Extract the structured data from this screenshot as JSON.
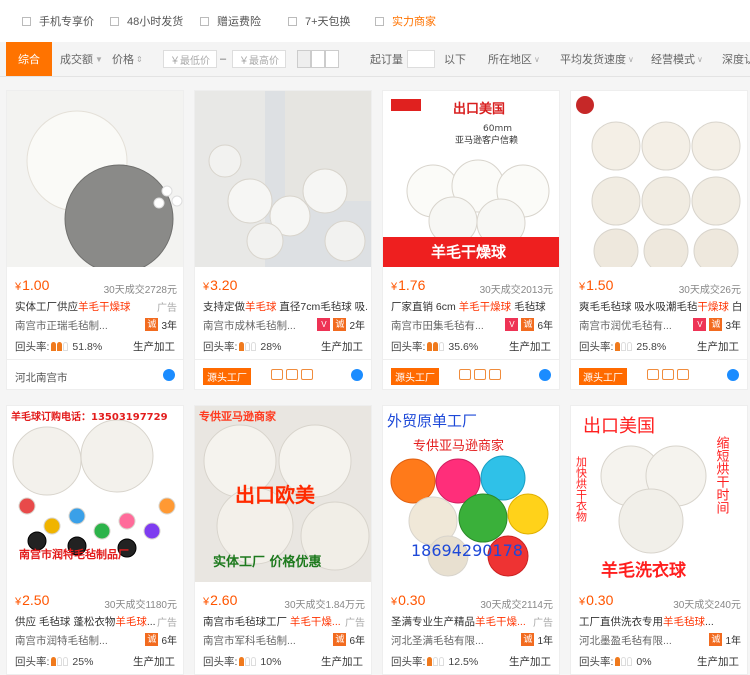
{
  "filters": [
    {
      "label": "手机专享价",
      "strong": false
    },
    {
      "label": "48小时发货",
      "strong": false
    },
    {
      "label": "赠运费险",
      "strong": false
    },
    {
      "label": "7+天包换",
      "strong": false
    },
    {
      "label": "实力商家",
      "strong": true
    }
  ],
  "sort": {
    "active": "综合",
    "volume": "成交额",
    "price": "价格",
    "min_price_placeholder": "￥最低价",
    "dash": "–",
    "max_price_placeholder": "￥最高价",
    "moq_label": "起订量",
    "below": "以下",
    "region": "所在地区",
    "ship_speed": "平均发货速度",
    "biz_mode": "经营模式",
    "depth": "深度认"
  },
  "products": [
    {
      "currency": "¥",
      "price": "1.00",
      "sold": "30天成交2728元",
      "title_pre": "实体工厂供应",
      "title_hl": "羊毛干燥球",
      "title_post": "",
      "ad": "广告",
      "crown": true,
      "shop": "南宫市正瑞毛毡制...",
      "vbadge": false,
      "years": "3年",
      "repeat_label": "回头率:",
      "repeat_rate": "51.8%",
      "repeat_level": 2,
      "mode": "生产加工",
      "location": "河北南宫市",
      "source_factory": ""
    },
    {
      "currency": "¥",
      "price": "3.20",
      "sold": "",
      "title_pre": "支持定做",
      "title_hl": "羊毛球",
      "title_post": " 直径7cm毛毡球 吸...",
      "ad": "",
      "crown": false,
      "shop": "南宫市成林毛毡制...",
      "vbadge": true,
      "years": "2年",
      "repeat_label": "回头率:",
      "repeat_rate": "28%",
      "repeat_level": 1,
      "mode": "生产加工",
      "location": "",
      "source_factory": "源头工厂"
    },
    {
      "currency": "¥",
      "price": "1.76",
      "sold": "30天成交2013元",
      "title_pre": "厂家直销 6cm ",
      "title_hl": "羊毛干燥球",
      "title_post": " 毛毡球",
      "ad": "",
      "crown": false,
      "shop": "南宫市田集毛毡有...",
      "vbadge": true,
      "years": "6年",
      "repeat_label": "回头率:",
      "repeat_rate": "35.6%",
      "repeat_level": 2,
      "mode": "生产加工",
      "location": "",
      "source_factory": "源头工厂"
    },
    {
      "currency": "¥",
      "price": "1.50",
      "sold": "30天成交26元",
      "title_pre": "爽毛毛毡球 吸水吸潮毛毡",
      "title_hl": "干燥球",
      "title_post": " 白...",
      "ad": "",
      "crown": false,
      "shop": "南宫市润优毛毡有...",
      "vbadge": true,
      "years": "3年",
      "repeat_label": "回头率:",
      "repeat_rate": "25.8%",
      "repeat_level": 1,
      "mode": "生产加工",
      "location": "",
      "source_factory": "源头工厂"
    },
    {
      "currency": "¥",
      "price": "2.50",
      "sold": "30天成交1180元",
      "title_pre": "供应 毛毡球 蓬松衣物",
      "title_hl": "羊毛球",
      "title_post": "...",
      "ad": "广告",
      "crown": false,
      "shop": "南宫市润特毛毡制...",
      "vbadge": false,
      "years": "6年",
      "repeat_label": "回头率:",
      "repeat_rate": "25%",
      "repeat_level": 1,
      "mode": "生产加工",
      "location": "",
      "source_factory": ""
    },
    {
      "currency": "¥",
      "price": "2.60",
      "sold": "30天成交1.84万元",
      "title_pre": "南宫市毛毡球工厂 ",
      "title_hl": "羊毛干燥...",
      "title_post": "",
      "ad": "广告",
      "crown": false,
      "shop": "南宫市军科毛毡制...",
      "vbadge": false,
      "years": "6年",
      "repeat_label": "回头率:",
      "repeat_rate": "10%",
      "repeat_level": 1,
      "mode": "生产加工",
      "location": "",
      "source_factory": ""
    },
    {
      "currency": "¥",
      "price": "0.30",
      "sold": "30天成交2114元",
      "title_pre": "圣满专业生产精品",
      "title_hl": "羊毛干燥...",
      "title_post": "",
      "ad": "广告",
      "crown": false,
      "shop": "河北圣满毛毡有限...",
      "vbadge": false,
      "years": "1年",
      "repeat_label": "回头率:",
      "repeat_rate": "12.5%",
      "repeat_level": 1,
      "mode": "生产加工",
      "location": "",
      "source_factory": ""
    },
    {
      "currency": "¥",
      "price": "0.30",
      "sold": "30天成交240元",
      "title_pre": "工厂直供洗衣专用",
      "title_hl": "羊毛毡球",
      "title_post": "...",
      "ad": "",
      "crown": false,
      "shop": "河北墨盈毛毡有限...",
      "vbadge": false,
      "years": "1年",
      "repeat_label": "回头率:",
      "repeat_rate": "0%",
      "repeat_level": 1,
      "mode": "生产加工",
      "location": "",
      "source_factory": ""
    }
  ],
  "overlays": {
    "p3_top": "出口美国",
    "p3_size": "60mm",
    "p3_sub": "亚马逊客户信赖",
    "p3_bottom": "羊毛干燥球",
    "p5_top": "羊毛球订购电话：13503197729",
    "p5_bottom": "南宫市润特毛毡制品厂",
    "p6_top": "专供亚马逊商家",
    "p6_mid": "出口欧美",
    "p6_bottom": "实体工厂 价格优惠",
    "p7_top": "外贸原单工厂",
    "p7_mid": "专供亚马逊商家",
    "p7_phone": "18694290178",
    "p8_top": "出口美国",
    "p8_side": "加快烘干衣物",
    "p8_side2": "缩短烘干时间",
    "p8_bottom": "羊毛洗衣球"
  },
  "colors": {
    "accent": "#ff7300",
    "price": "#ff5500",
    "highlight": "#ff3300",
    "badge_blue": "#1b8cff"
  }
}
